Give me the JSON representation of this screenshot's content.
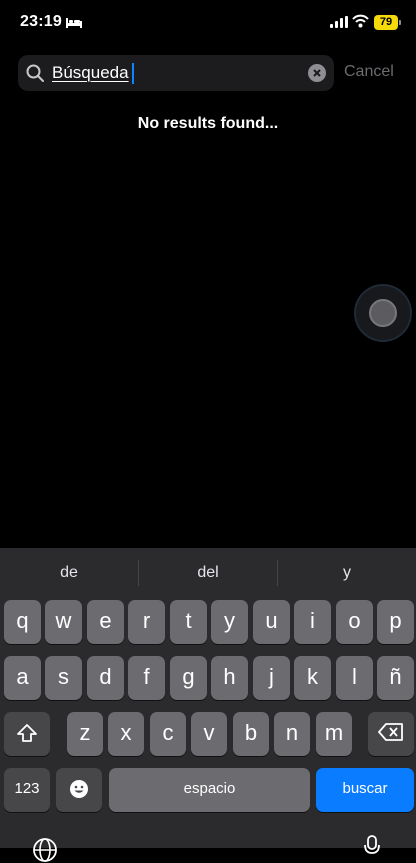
{
  "status_bar": {
    "time": "23:19",
    "battery": "79"
  },
  "search": {
    "query": "Búsqueda",
    "cancel_label": "Cancel"
  },
  "results": {
    "empty_message": "No results found..."
  },
  "keyboard": {
    "suggestions": [
      "de",
      "del",
      "y"
    ],
    "row1": [
      "q",
      "w",
      "e",
      "r",
      "t",
      "y",
      "u",
      "i",
      "o",
      "p"
    ],
    "row2": [
      "a",
      "s",
      "d",
      "f",
      "g",
      "h",
      "j",
      "k",
      "l",
      "ñ"
    ],
    "row3": [
      "z",
      "x",
      "c",
      "v",
      "b",
      "n",
      "m"
    ],
    "numbers_label": "123",
    "space_label": "espacio",
    "search_label": "buscar",
    "colors": {
      "key": "#6b6b70",
      "special_key": "#474749",
      "action_key": "#0a7cff"
    }
  }
}
